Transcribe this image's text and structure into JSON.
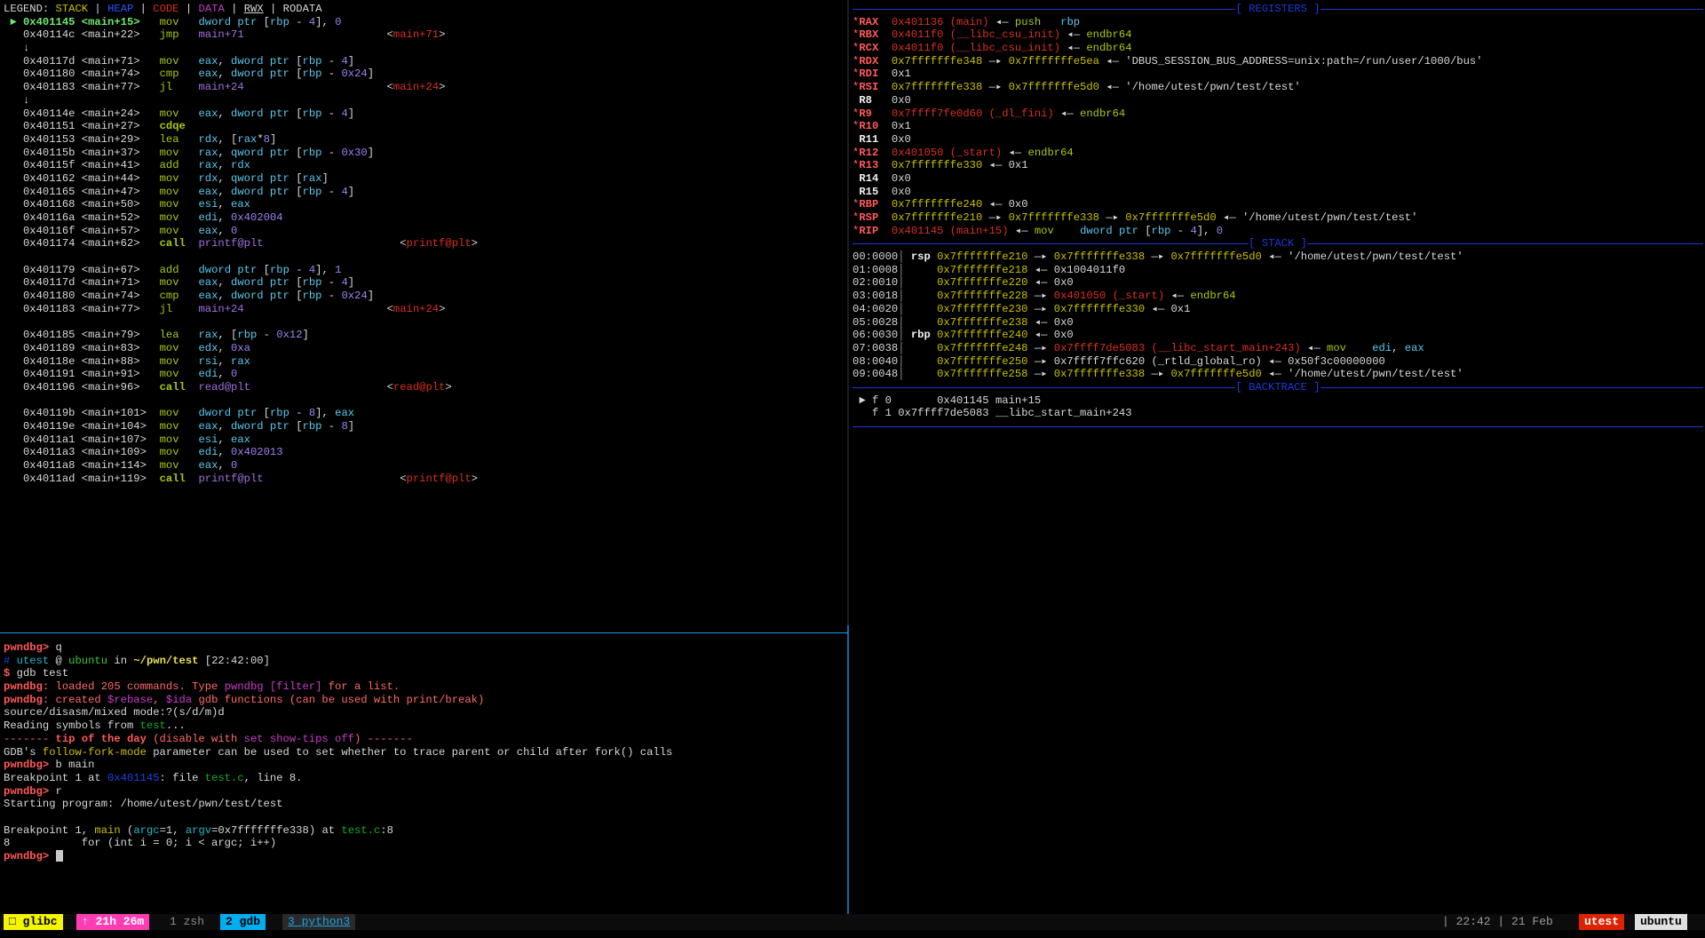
{
  "legend": {
    "label": "LEGEND:",
    "items": [
      "STACK",
      "HEAP",
      "CODE",
      "DATA",
      "RWX",
      "RODATA"
    ]
  },
  "disasm": [
    {
      "current": true,
      "addr": "0x401145",
      "sym": "<main+15>",
      "op": "mov",
      "args": "dword ptr [rbp - 4], 0",
      "target": ""
    },
    {
      "addr": "0x40114c",
      "sym": "<main+22>",
      "op": "jmp",
      "args": "main+71",
      "target": "<main+71>"
    },
    {
      "arrow": "↓"
    },
    {
      "addr": "0x40117d",
      "sym": "<main+71>",
      "op": "mov",
      "args": "eax, dword ptr [rbp - 4]",
      "target": ""
    },
    {
      "addr": "0x401180",
      "sym": "<main+74>",
      "op": "cmp",
      "args": "eax, dword ptr [rbp - 0x24]",
      "target": ""
    },
    {
      "addr": "0x401183",
      "sym": "<main+77>",
      "op": "jl",
      "args": "main+24",
      "target": "<main+24>"
    },
    {
      "arrow": "↓"
    },
    {
      "addr": "0x40114e",
      "sym": "<main+24>",
      "op": "mov",
      "args": "eax, dword ptr [rbp - 4]",
      "target": ""
    },
    {
      "addr": "0x401151",
      "sym": "<main+27>",
      "op": "cdqe",
      "args": "",
      "target": ""
    },
    {
      "addr": "0x401153",
      "sym": "<main+29>",
      "op": "lea",
      "args": "rdx, [rax*8]",
      "target": ""
    },
    {
      "addr": "0x40115b",
      "sym": "<main+37>",
      "op": "mov",
      "args": "rax, qword ptr [rbp - 0x30]",
      "target": ""
    },
    {
      "addr": "0x40115f",
      "sym": "<main+41>",
      "op": "add",
      "args": "rax, rdx",
      "target": ""
    },
    {
      "addr": "0x401162",
      "sym": "<main+44>",
      "op": "mov",
      "args": "rdx, qword ptr [rax]",
      "target": ""
    },
    {
      "addr": "0x401165",
      "sym": "<main+47>",
      "op": "mov",
      "args": "eax, dword ptr [rbp - 4]",
      "target": ""
    },
    {
      "addr": "0x401168",
      "sym": "<main+50>",
      "op": "mov",
      "args": "esi, eax",
      "target": ""
    },
    {
      "addr": "0x40116a",
      "sym": "<main+52>",
      "op": "mov",
      "args": "edi, 0x402004",
      "target": ""
    },
    {
      "addr": "0x40116f",
      "sym": "<main+57>",
      "op": "mov",
      "args": "eax, 0",
      "target": ""
    },
    {
      "addr": "0x401174",
      "sym": "<main+62>",
      "op": "call",
      "args": "printf@plt",
      "target": "<printf@plt>"
    },
    {
      "blank": true
    },
    {
      "addr": "0x401179",
      "sym": "<main+67>",
      "op": "add",
      "args": "dword ptr [rbp - 4], 1",
      "target": ""
    },
    {
      "addr": "0x40117d",
      "sym": "<main+71>",
      "op": "mov",
      "args": "eax, dword ptr [rbp - 4]",
      "target": ""
    },
    {
      "addr": "0x401180",
      "sym": "<main+74>",
      "op": "cmp",
      "args": "eax, dword ptr [rbp - 0x24]",
      "target": ""
    },
    {
      "addr": "0x401183",
      "sym": "<main+77>",
      "op": "jl",
      "args": "main+24",
      "target": "<main+24>"
    },
    {
      "blank": true
    },
    {
      "addr": "0x401185",
      "sym": "<main+79>",
      "op": "lea",
      "args": "rax, [rbp - 0x12]",
      "target": ""
    },
    {
      "addr": "0x401189",
      "sym": "<main+83>",
      "op": "mov",
      "args": "edx, 0xa",
      "target": ""
    },
    {
      "addr": "0x40118e",
      "sym": "<main+88>",
      "op": "mov",
      "args": "rsi, rax",
      "target": ""
    },
    {
      "addr": "0x401191",
      "sym": "<main+91>",
      "op": "mov",
      "args": "edi, 0",
      "target": ""
    },
    {
      "addr": "0x401196",
      "sym": "<main+96>",
      "op": "call",
      "args": "read@plt",
      "target": "<read@plt>"
    },
    {
      "blank": true
    },
    {
      "addr": "0x40119b",
      "sym": "<main+101>",
      "op": "mov",
      "args": "dword ptr [rbp - 8], eax",
      "target": ""
    },
    {
      "addr": "0x40119e",
      "sym": "<main+104>",
      "op": "mov",
      "args": "eax, dword ptr [rbp - 8]",
      "target": ""
    },
    {
      "addr": "0x4011a1",
      "sym": "<main+107>",
      "op": "mov",
      "args": "esi, eax",
      "target": ""
    },
    {
      "addr": "0x4011a3",
      "sym": "<main+109>",
      "op": "mov",
      "args": "edi, 0x402013",
      "target": ""
    },
    {
      "addr": "0x4011a8",
      "sym": "<main+114>",
      "op": "mov",
      "args": "eax, 0",
      "target": ""
    },
    {
      "addr": "0x4011ad",
      "sym": "<main+119>",
      "op": "call",
      "args": "printf@plt",
      "target": "<printf@plt>"
    }
  ],
  "console": {
    "lines": [
      [
        {
          "t": "pwndbg>",
          "c": "c-pwn"
        },
        {
          "t": " q"
        }
      ],
      [
        {
          "t": "# ",
          "c": "c-dblue"
        },
        {
          "t": "utest",
          "c": "c-cyan"
        },
        {
          "t": " @ "
        },
        {
          "t": "ubuntu",
          "c": "c-lgreen"
        },
        {
          "t": " in "
        },
        {
          "t": "~/pwn/test",
          "c": "c-ylw c-b"
        },
        {
          "t": " [22:42:00]"
        }
      ],
      [
        {
          "t": "$",
          "c": "c-pwn"
        },
        {
          "t": " gdb test"
        }
      ],
      [
        {
          "t": "pwndbg:",
          "c": "c-pwn"
        },
        {
          "t": " loaded 205 commands. Type ",
          "c": "c-pink"
        },
        {
          "t": "pwndbg [filter]",
          "c": "c-mag"
        },
        {
          "t": " for a list.",
          "c": "c-pink"
        }
      ],
      [
        {
          "t": "pwndbg:",
          "c": "c-pwn"
        },
        {
          "t": " created ",
          "c": "c-pink"
        },
        {
          "t": "$rebase",
          "c": "c-mag"
        },
        {
          "t": ", ",
          "c": "c-pink"
        },
        {
          "t": "$ida",
          "c": "c-mag"
        },
        {
          "t": " gdb functions (can be used with print/break)",
          "c": "c-pink"
        }
      ],
      [
        {
          "t": "source/disasm/mixed mode:?(s/d/m)d"
        }
      ],
      [
        {
          "t": "Reading symbols from "
        },
        {
          "t": "test",
          "c": "c-grn2"
        },
        {
          "t": "..."
        }
      ],
      [
        {
          "t": "------- ",
          "c": "c-pink"
        },
        {
          "t": "tip of the day",
          "c": "c-pwn"
        },
        {
          "t": " (disable with ",
          "c": "c-pink"
        },
        {
          "t": "set show-tips off",
          "c": "c-mag"
        },
        {
          "t": ") -------",
          "c": "c-pink"
        }
      ],
      [
        {
          "t": "GDB's "
        },
        {
          "t": "follow-fork-mode",
          "c": "c-yellow"
        },
        {
          "t": " parameter can be used to set whether to trace parent or child after fork() calls"
        }
      ],
      [
        {
          "t": "pwndbg>",
          "c": "c-pwn"
        },
        {
          "t": " b main"
        }
      ],
      [
        {
          "t": "Breakpoint 1 at "
        },
        {
          "t": "0x401145",
          "c": "c-dblue"
        },
        {
          "t": ": file "
        },
        {
          "t": "test.c",
          "c": "c-grn2"
        },
        {
          "t": ", line 8."
        }
      ],
      [
        {
          "t": "pwndbg>",
          "c": "c-pwn"
        },
        {
          "t": " r"
        }
      ],
      [
        {
          "t": "Starting program: /home/utest/pwn/test/test"
        }
      ],
      [
        {
          "t": ""
        }
      ],
      [
        {
          "t": "Breakpoint 1, "
        },
        {
          "t": "main",
          "c": "c-yellow"
        },
        {
          "t": " ("
        },
        {
          "t": "argc",
          "c": "c-cyan"
        },
        {
          "t": "=1, "
        },
        {
          "t": "argv",
          "c": "c-cyan"
        },
        {
          "t": "=0x7fffffffe338) at "
        },
        {
          "t": "test.c",
          "c": "c-grn2"
        },
        {
          "t": ":8"
        }
      ],
      [
        {
          "t": "8           for (int i = 0; i < argc; i++)"
        }
      ]
    ],
    "prompt": "pwndbg>"
  },
  "registers_title": "[ REGISTERS ]",
  "registers": [
    {
      "mod": true,
      "name": "RAX",
      "parts": [
        {
          "t": "0x401136 (main)",
          "c": "c-code"
        },
        {
          "t": " ◂— "
        },
        {
          "t": "push",
          "c": "c-instr"
        },
        {
          "t": "   "
        },
        {
          "t": "rbp",
          "c": "c-reg"
        }
      ]
    },
    {
      "mod": true,
      "name": "RBX",
      "parts": [
        {
          "t": "0x4011f0 (__libc_csu_init)",
          "c": "c-code"
        },
        {
          "t": " ◂— "
        },
        {
          "t": "endbr64",
          "c": "c-instr"
        }
      ]
    },
    {
      "mod": true,
      "name": "RCX",
      "parts": [
        {
          "t": "0x4011f0 (__libc_csu_init)",
          "c": "c-code"
        },
        {
          "t": " ◂— "
        },
        {
          "t": "endbr64",
          "c": "c-instr"
        }
      ]
    },
    {
      "mod": true,
      "name": "RDX",
      "parts": [
        {
          "t": "0x7fffffffe348",
          "c": "c-stack"
        },
        {
          "t": " —▸ "
        },
        {
          "t": "0x7fffffffe5ea",
          "c": "c-stack"
        },
        {
          "t": " ◂— 'DBUS_SESSION_BUS_ADDRESS=unix:path=/run/user/1000/bus'"
        }
      ]
    },
    {
      "mod": true,
      "name": "RDI",
      "parts": [
        {
          "t": "0x1"
        }
      ]
    },
    {
      "mod": true,
      "name": "RSI",
      "parts": [
        {
          "t": "0x7fffffffe338",
          "c": "c-stack"
        },
        {
          "t": " —▸ "
        },
        {
          "t": "0x7fffffffe5d0",
          "c": "c-stack"
        },
        {
          "t": " ◂— '/home/utest/pwn/test/test'"
        }
      ]
    },
    {
      "mod": false,
      "name": "R8",
      "parts": [
        {
          "t": "0x0"
        }
      ]
    },
    {
      "mod": true,
      "name": "R9",
      "parts": [
        {
          "t": "0x7ffff7fe0d60 (_dl_fini)",
          "c": "c-code"
        },
        {
          "t": " ◂— "
        },
        {
          "t": "endbr64",
          "c": "c-instr"
        }
      ]
    },
    {
      "mod": true,
      "name": "R10",
      "parts": [
        {
          "t": "0x1"
        }
      ]
    },
    {
      "mod": false,
      "name": "R11",
      "parts": [
        {
          "t": "0x0"
        }
      ]
    },
    {
      "mod": true,
      "name": "R12",
      "parts": [
        {
          "t": "0x401050 (_start)",
          "c": "c-code"
        },
        {
          "t": " ◂— "
        },
        {
          "t": "endbr64",
          "c": "c-instr"
        }
      ]
    },
    {
      "mod": true,
      "name": "R13",
      "parts": [
        {
          "t": "0x7fffffffe330",
          "c": "c-stack"
        },
        {
          "t": " ◂— 0x1"
        }
      ]
    },
    {
      "mod": false,
      "name": "R14",
      "parts": [
        {
          "t": "0x0"
        }
      ]
    },
    {
      "mod": false,
      "name": "R15",
      "parts": [
        {
          "t": "0x0"
        }
      ]
    },
    {
      "mod": true,
      "name": "RBP",
      "parts": [
        {
          "t": "0x7fffffffe240",
          "c": "c-stack"
        },
        {
          "t": " ◂— 0x0"
        }
      ]
    },
    {
      "mod": true,
      "name": "RSP",
      "parts": [
        {
          "t": "0x7fffffffe210",
          "c": "c-stack"
        },
        {
          "t": " —▸ "
        },
        {
          "t": "0x7fffffffe338",
          "c": "c-stack"
        },
        {
          "t": " —▸ "
        },
        {
          "t": "0x7fffffffe5d0",
          "c": "c-stack"
        },
        {
          "t": " ◂— '/home/utest/pwn/test/test'"
        }
      ]
    },
    {
      "mod": true,
      "name": "RIP",
      "parts": [
        {
          "t": "0x401145 (main+15)",
          "c": "c-code"
        },
        {
          "t": " ◂— "
        },
        {
          "t": "mov",
          "c": "c-instr"
        },
        {
          "t": "    "
        },
        {
          "t": "dword ptr ",
          "c": "c-reg"
        },
        {
          "t": "["
        },
        {
          "t": "rbp",
          "c": "c-reg"
        },
        {
          "t": " - "
        },
        {
          "t": "4",
          "c": "c-num"
        },
        {
          "t": "], "
        },
        {
          "t": "0",
          "c": "c-num"
        }
      ]
    }
  ],
  "stack_title": "[ STACK ]",
  "stack": [
    {
      "off": "00:0000",
      "reg": "rsp",
      "parts": [
        {
          "t": "0x7fffffffe210",
          "c": "c-stack"
        },
        {
          "t": " —▸ "
        },
        {
          "t": "0x7fffffffe338",
          "c": "c-stack"
        },
        {
          "t": " —▸ "
        },
        {
          "t": "0x7fffffffe5d0",
          "c": "c-stack"
        },
        {
          "t": " ◂— '/home/utest/pwn/test/test'"
        }
      ]
    },
    {
      "off": "01:0008",
      "reg": "",
      "parts": [
        {
          "t": "0x7fffffffe218",
          "c": "c-stack"
        },
        {
          "t": " ◂— 0x1004011f0"
        }
      ]
    },
    {
      "off": "02:0010",
      "reg": "",
      "parts": [
        {
          "t": "0x7fffffffe220",
          "c": "c-stack"
        },
        {
          "t": " ◂— 0x0"
        }
      ]
    },
    {
      "off": "03:0018",
      "reg": "",
      "parts": [
        {
          "t": "0x7fffffffe228",
          "c": "c-stack"
        },
        {
          "t": " —▸ "
        },
        {
          "t": "0x401050 (_start)",
          "c": "c-code"
        },
        {
          "t": " ◂— "
        },
        {
          "t": "endbr64",
          "c": "c-instr"
        }
      ]
    },
    {
      "off": "04:0020",
      "reg": "",
      "parts": [
        {
          "t": "0x7fffffffe230",
          "c": "c-stack"
        },
        {
          "t": " —▸ "
        },
        {
          "t": "0x7fffffffe330",
          "c": "c-stack"
        },
        {
          "t": " ◂— 0x1"
        }
      ]
    },
    {
      "off": "05:0028",
      "reg": "",
      "parts": [
        {
          "t": "0x7fffffffe238",
          "c": "c-stack"
        },
        {
          "t": " ◂— 0x0"
        }
      ]
    },
    {
      "off": "06:0030",
      "reg": "rbp",
      "parts": [
        {
          "t": "0x7fffffffe240",
          "c": "c-stack"
        },
        {
          "t": " ◂— 0x0"
        }
      ]
    },
    {
      "off": "07:0038",
      "reg": "",
      "parts": [
        {
          "t": "0x7fffffffe248",
          "c": "c-stack"
        },
        {
          "t": " —▸ "
        },
        {
          "t": "0x7ffff7de5083 (__libc_start_main+243)",
          "c": "c-code"
        },
        {
          "t": " ◂— "
        },
        {
          "t": "mov",
          "c": "c-instr"
        },
        {
          "t": "    "
        },
        {
          "t": "edi",
          "c": "c-reg"
        },
        {
          "t": ", "
        },
        {
          "t": "eax",
          "c": "c-reg"
        }
      ]
    },
    {
      "off": "08:0040",
      "reg": "",
      "parts": [
        {
          "t": "0x7fffffffe250",
          "c": "c-stack"
        },
        {
          "t": " —▸ 0x7ffff7ffc620 (_rtld_global_ro) ◂— 0x50f3c00000000"
        }
      ]
    },
    {
      "off": "09:0048",
      "reg": "",
      "parts": [
        {
          "t": "0x7fffffffe258",
          "c": "c-stack"
        },
        {
          "t": " —▸ "
        },
        {
          "t": "0x7fffffffe338",
          "c": "c-stack"
        },
        {
          "t": " —▸ "
        },
        {
          "t": "0x7fffffffe5d0",
          "c": "c-stack"
        },
        {
          "t": " ◂— '/home/utest/pwn/test/test'"
        }
      ]
    }
  ],
  "backtrace_title": "[ BACKTRACE ]",
  "backtrace": [
    {
      "marker": "►",
      "frame": "f 0",
      "addr": "0x401145",
      "sym": "main+15"
    },
    {
      "marker": "",
      "frame": "f 1",
      "addr": "0x7ffff7de5083",
      "sym": "__libc_start_main+243"
    }
  ],
  "statusbar": {
    "session": "□ glibc",
    "uptime": "↑ 21h 26m",
    "windows": [
      {
        "label": "1 zsh",
        "active": false
      },
      {
        "label": "2 gdb",
        "active": true
      },
      {
        "label": "3 python3",
        "active": false,
        "bell": true
      }
    ],
    "clock": "| 22:42 | 21 Feb",
    "user": "utest",
    "host": "ubuntu"
  },
  "colors": {
    "stack": "#c9c100",
    "heap": "#2a55ff",
    "code": "#d8311a",
    "data": "#c83cc8",
    "section_rule": "#1a3ad8",
    "pane_border": "#1aa0e0",
    "session_bg": "#f5f500",
    "uptime_bg": "#ff3cb4",
    "active_window_bg": "#00aef0",
    "user_bg": "#dd2200",
    "host_bg": "#e0e0e0"
  }
}
